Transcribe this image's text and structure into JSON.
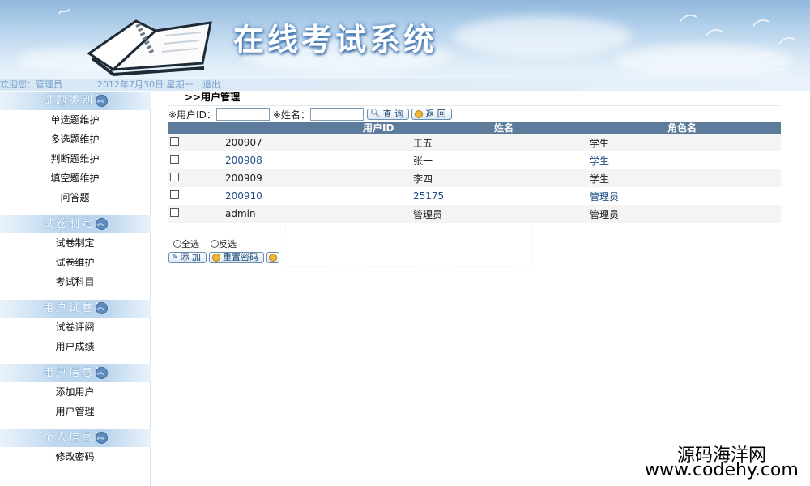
{
  "header": {
    "title": "在线考试系统"
  },
  "status": {
    "welcome": "欢迎您：管理员",
    "date": "2012年7月30日 星期一",
    "logout": "退出"
  },
  "sidebar": {
    "groups": [
      {
        "title": "试题类别管",
        "items": [
          "单选题维护",
          "多选题维护",
          "判断题维护",
          "填空题维护",
          "问答题"
        ]
      },
      {
        "title": "试卷制定维",
        "items": [
          "试卷制定",
          "试卷维护",
          "考试科目"
        ]
      },
      {
        "title": "用户试卷管",
        "items": [
          "试卷评阅",
          "用户成绩"
        ]
      },
      {
        "title": "用户信息管",
        "items": [
          "添加用户",
          "用户管理"
        ]
      },
      {
        "title": "个人信息管",
        "items": [
          "修改密码"
        ]
      }
    ]
  },
  "main": {
    "breadcrumb": ">>用户管理",
    "search": {
      "userid_label": "※用户ID：",
      "userid_value": "",
      "name_label": "※姓名：",
      "name_value": "",
      "query_btn": "查 询",
      "back_btn": "返 回"
    },
    "table": {
      "columns": [
        "用户ID",
        "姓名",
        "角色名"
      ],
      "rows": [
        {
          "id": "200907",
          "name": "王五",
          "role": "学生"
        },
        {
          "id": "200908",
          "name": "张一",
          "role": "学生"
        },
        {
          "id": "200909",
          "name": "李四",
          "role": "学生"
        },
        {
          "id": "200910",
          "name": "25175",
          "role": "管理员"
        },
        {
          "id": "admin",
          "name": "管理员",
          "role": "管理员"
        }
      ]
    },
    "select_all": "全选",
    "select_invert": "反选",
    "add_btn": "添 加",
    "reset_pwd_btn": "重置密码"
  },
  "watermark": {
    "line1": "源码海洋网",
    "line2": "www.codehy.com"
  }
}
